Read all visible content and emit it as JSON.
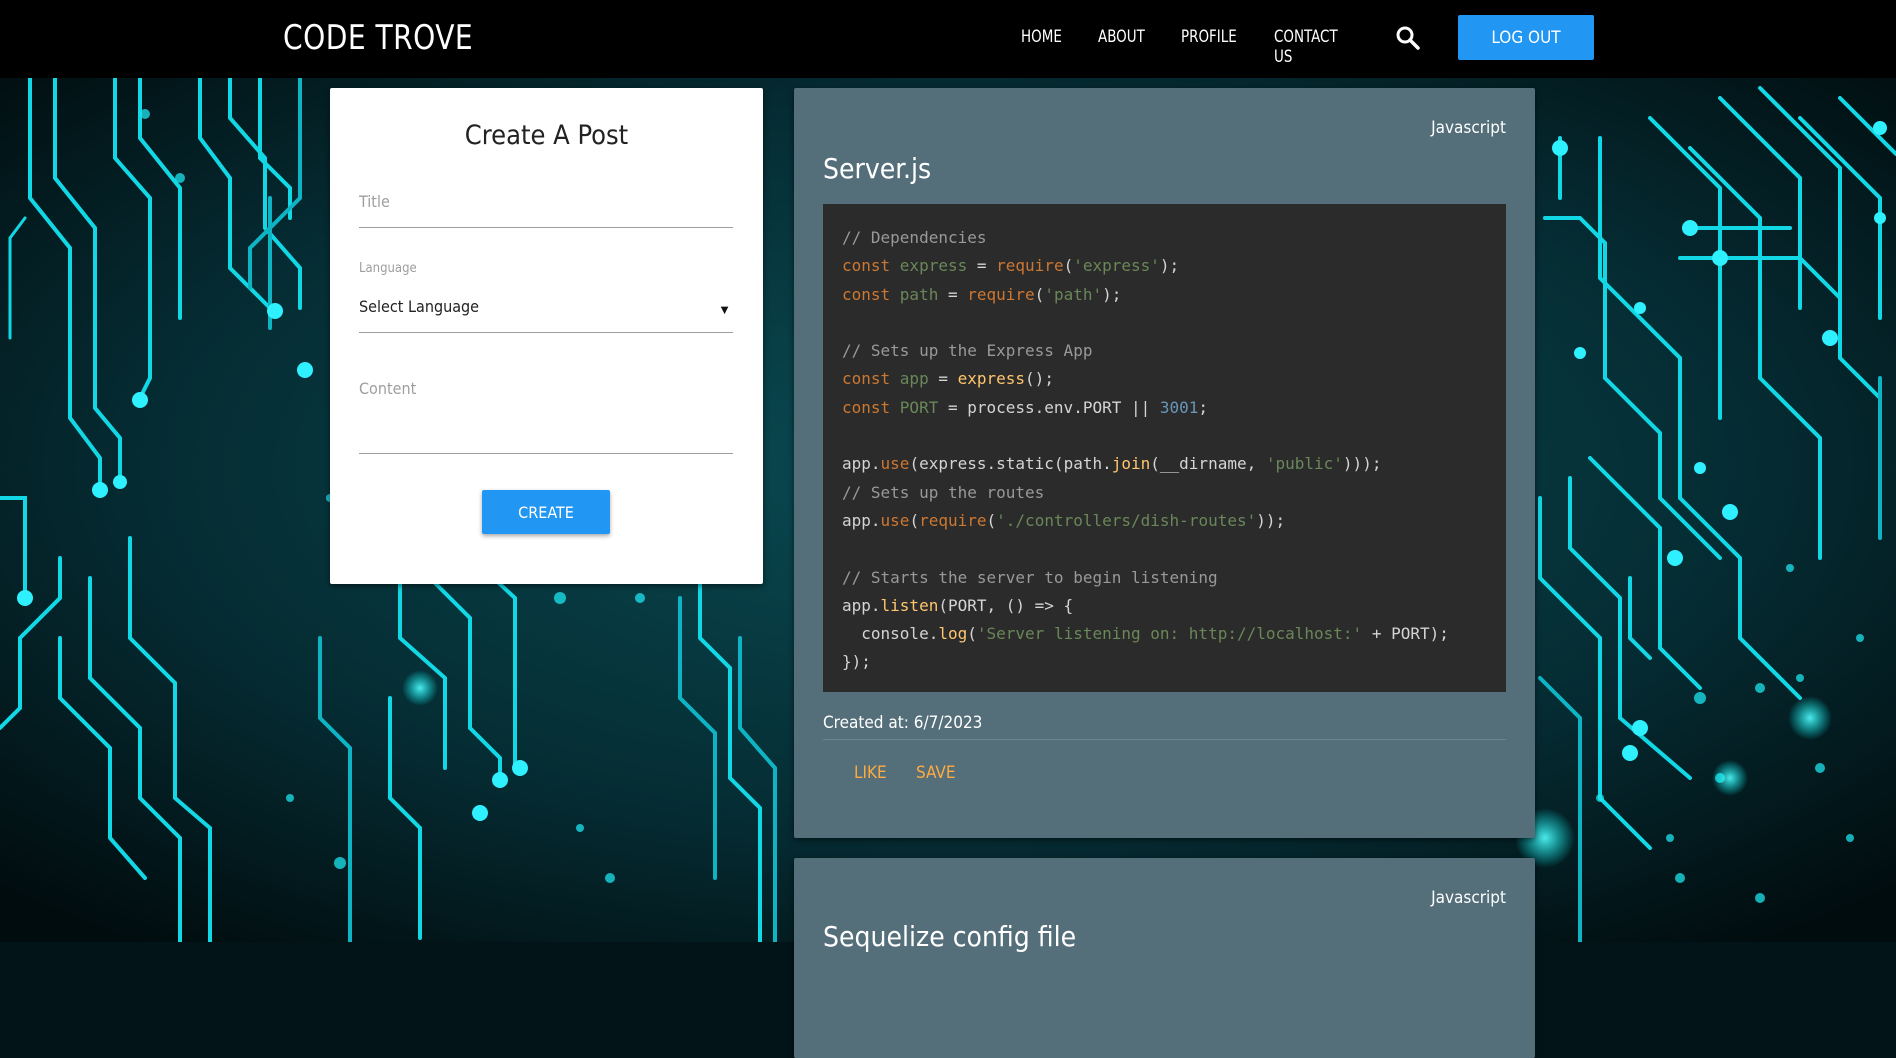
{
  "nav": {
    "brand": "CODE TROVE",
    "links": [
      "HOME",
      "ABOUT",
      "PROFILE",
      "CONTACT US"
    ],
    "search_icon": "search-icon",
    "logout_label": "LOG OUT"
  },
  "create_post": {
    "heading": "Create A Post",
    "title_placeholder": "Title",
    "language_label": "Language",
    "language_selected": "Select Language",
    "content_placeholder": "Content",
    "create_label": "CREATE"
  },
  "posts": [
    {
      "language": "Javascript",
      "title": "Server.js",
      "created": "Created at: 6/7/2023",
      "like_label": "LIKE",
      "save_label": "SAVE",
      "code": [
        "// Dependencies",
        "const express = require('express');",
        "const path = require('path');",
        "",
        "// Sets up the Express App",
        "const app = express();",
        "const PORT = process.env.PORT || 3001;",
        "",
        "app.use(express.static(path.join(__dirname, 'public')));",
        "// Sets up the routes",
        "app.use(require('./controllers/dish-routes'));",
        "",
        "// Starts the server to begin listening",
        "app.listen(PORT, () => {",
        "  console.log('Server listening on: http://localhost:' + PORT);",
        "});"
      ]
    },
    {
      "language": "Javascript",
      "title": "Sequelize config file"
    }
  ],
  "colors": {
    "accent": "#2196f3",
    "card_dark": "#546e7a",
    "action": "#ffab40",
    "circuit": "#00e5ee"
  }
}
